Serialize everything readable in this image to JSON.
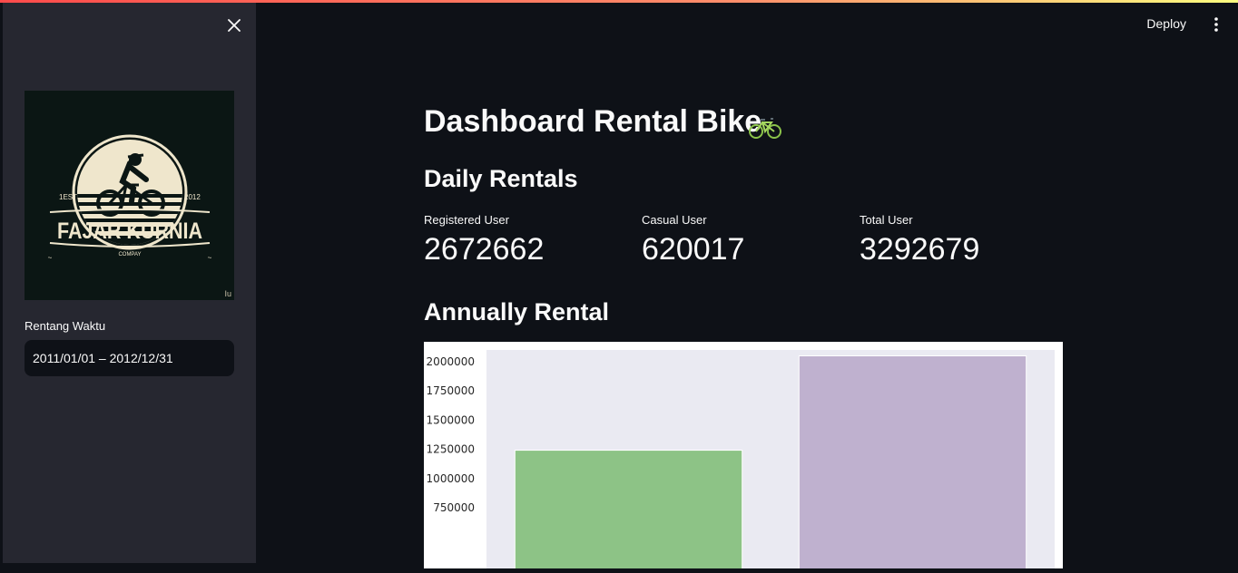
{
  "sidebar": {
    "logo": {
      "est_left": "1EST",
      "est_right": "2012",
      "name": "FAJAR KURNIA",
      "sub": "COMPAY",
      "mark": "Iu"
    },
    "date_label": "Rentang Waktu",
    "date_value": "2011/01/01 – 2012/12/31"
  },
  "header": {
    "deploy": "Deploy"
  },
  "main": {
    "title": "Dashboard Rental Bike",
    "daily_heading": "Daily Rentals",
    "metrics": [
      {
        "label": "Registered User",
        "value": "2672662"
      },
      {
        "label": "Casual User",
        "value": "620017"
      },
      {
        "label": "Total User",
        "value": "3292679"
      }
    ],
    "annual_heading": "Annually Rental"
  },
  "colors": {
    "accent_line_start": "#ff4b4b",
    "bar_2011": "#8dc386",
    "bar_2012": "#bfb1cf",
    "plot_bg": "#eaeaf2"
  },
  "chart_data": {
    "type": "bar",
    "categories": [
      "",
      ""
    ],
    "values": [
      1243103,
      2049576
    ],
    "ylim": [
      0,
      2100000
    ],
    "yticks": [
      "750000",
      "1000000",
      "1250000",
      "1500000",
      "1750000",
      "2000000"
    ],
    "grid": false
  }
}
